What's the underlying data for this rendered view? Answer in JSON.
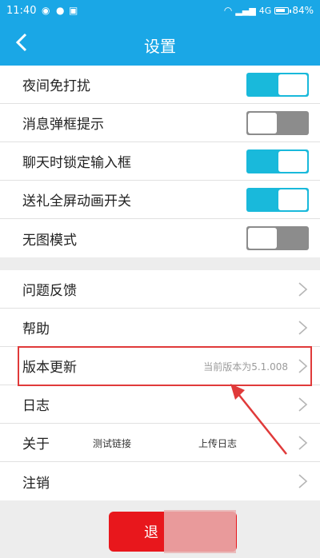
{
  "status_bar": {
    "time": "11:40",
    "network": "4G",
    "battery": "84%",
    "battery_fraction": 0.84
  },
  "header": {
    "back_icon": "chevron-left-icon",
    "title": "设置"
  },
  "toggles": [
    {
      "label": "夜间免打扰",
      "on": true
    },
    {
      "label": "消息弹框提示",
      "on": false
    },
    {
      "label": "聊天时锁定输入框",
      "on": true
    },
    {
      "label": "送礼全屏动画开关",
      "on": true
    },
    {
      "label": "无图模式",
      "on": false
    }
  ],
  "menu": {
    "feedback": "问题反馈",
    "help": "帮助",
    "update": "版本更新",
    "update_hint": "当前版本为5.1.008",
    "log": "日志",
    "about": "关于",
    "test_link": "测试链接",
    "upload_log": "上传日志",
    "logout_item": "注销"
  },
  "footer": {
    "logout_button": "退"
  },
  "colors": {
    "primary": "#1aa7e6",
    "toggle_on": "#19b9db",
    "toggle_off": "#8c8c8c",
    "annotation": "#e03a3a",
    "logout": "#e8171c"
  }
}
